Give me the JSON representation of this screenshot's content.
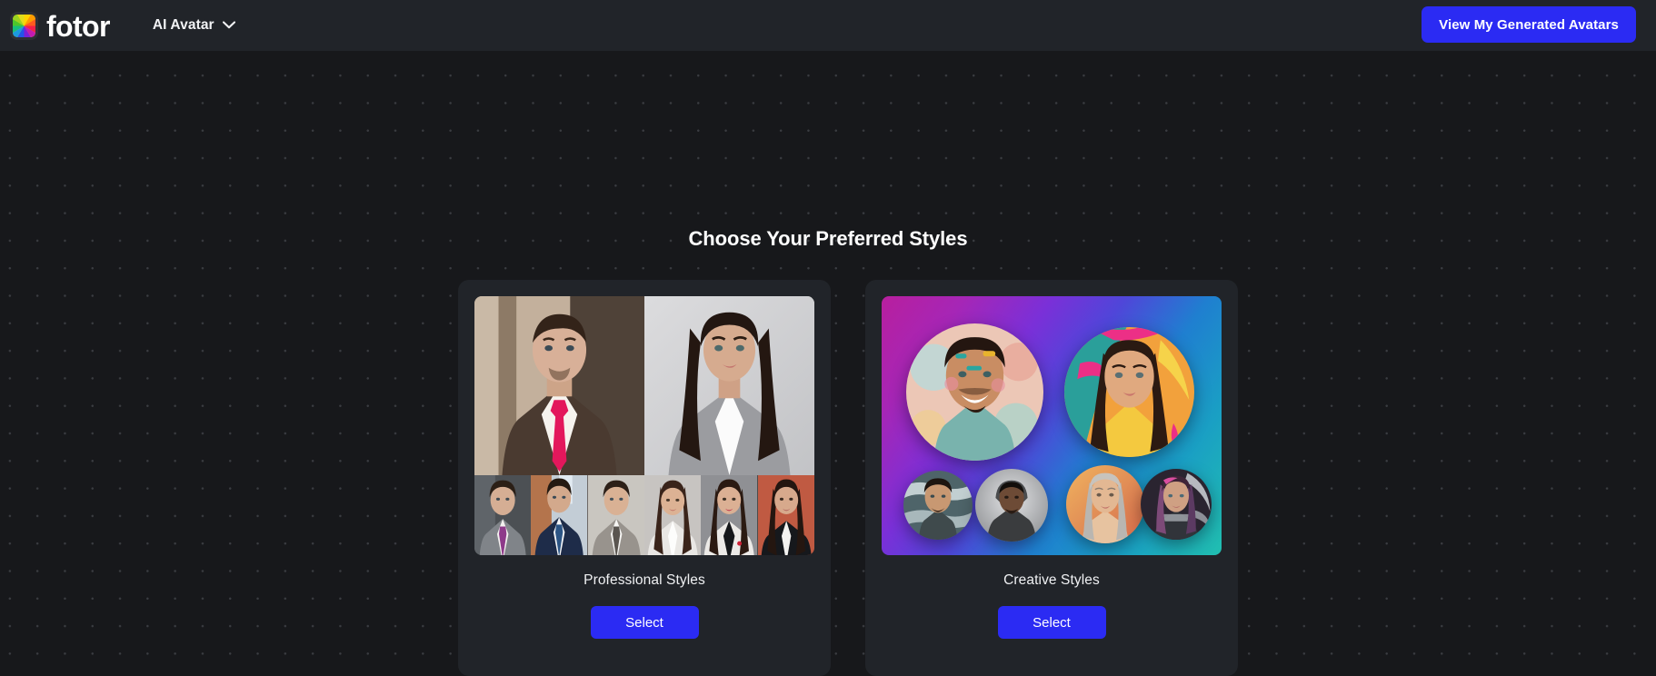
{
  "header": {
    "brand_name": "fotor",
    "brand_icon": "fotor-color-wheel-logo",
    "nav": {
      "label": "AI Avatar",
      "chevron_icon": "chevron-down-icon"
    },
    "cta_label": "View My Generated Avatars"
  },
  "main": {
    "heading": "Choose Your Preferred Styles",
    "cards": [
      {
        "id": "professional",
        "title": "Professional Styles",
        "button_label": "Select",
        "preview": {
          "type": "photo-grid",
          "hero": [
            {
              "alt": "man in brown suit with pink tie",
              "bg": "#b9a696",
              "suit": "#4a3a30",
              "tie": "#e3175c",
              "skin": "#d8b098",
              "hair": "#332319"
            },
            {
              "alt": "woman in grey blazer",
              "bg": "#cfd0d2",
              "suit": "#9b9ca0",
              "tie": "#ffffff",
              "skin": "#d6ab8f",
              "hair": "#221611"
            }
          ],
          "thumbs": [
            {
              "alt": "man grey suit purple tie",
              "bg": "#55585c",
              "suit": "#808489",
              "tie": "#8e3a8a",
              "skin": "#d5ae94",
              "hair": "#2b1f16"
            },
            {
              "alt": "man navy suit blue tie",
              "bg": "#b4744c",
              "suit": "#1e2c49",
              "tie": "#2c5585",
              "skin": "#d3a98c",
              "hair": "#251a12"
            },
            {
              "alt": "man light grey suit",
              "bg": "#c9c6c0",
              "suit": "#98938d",
              "tie": "#5a5550",
              "skin": "#d9b194",
              "hair": "#2d2018"
            },
            {
              "alt": "woman white blazer",
              "bg": "#c7c4c1",
              "suit": "#e9e7e4",
              "tie": "#ffffff",
              "skin": "#dcb294",
              "hair": "#3a241a"
            },
            {
              "alt": "woman white blazer black top",
              "bg": "#8f9094",
              "suit": "#eceae7",
              "tie": "#15171a",
              "skin": "#dbb094",
              "hair": "#2b1a12"
            },
            {
              "alt": "woman black blazer orange backdrop",
              "bg": "#c05a42",
              "suit": "#16181c",
              "tie": "#ffffff",
              "skin": "#d7a98c",
              "hair": "#241610"
            }
          ]
        }
      },
      {
        "id": "creative",
        "title": "Creative Styles",
        "button_label": "Select",
        "preview": {
          "type": "gradient-orbs",
          "gradient": [
            "#b81f9e",
            "#7a30d8",
            "#1f7fd0",
            "#21bfb0"
          ],
          "orbs": [
            {
              "alt": "man with colorful paint splashes",
              "size": "large",
              "bg": "#e8c3b4",
              "skin": "#c98d63",
              "hair": "#241610",
              "accent": "#2aa6a0"
            },
            {
              "alt": "woman painted portrait orange pink",
              "size": "large",
              "bg": "#f2a13c",
              "skin": "#e0a97f",
              "hair": "#2a1a12",
              "accent": "#ec2f86"
            },
            {
              "alt": "man cloudy sky backdrop",
              "size": "small",
              "bg": "#4e6469",
              "skin": "#c89872",
              "hair": "#1d1510",
              "accent": "#d7e2e4"
            },
            {
              "alt": "man in hoodie greyscale",
              "size": "small",
              "bg": "#b7b9bb",
              "skin": "#6d4b36",
              "hair": "#120e0b",
              "accent": "#3a3c3e"
            },
            {
              "alt": "woman silver hair warm backdrop",
              "size": "small",
              "bg": "#e8a65a",
              "skin": "#e3b893",
              "hair": "#b9b6b1",
              "accent": "#d96a4a"
            },
            {
              "alt": "woman cyberpunk pink highlights",
              "size": "small",
              "bg": "#2a2430",
              "skin": "#cfa083",
              "hair": "#7d4a78",
              "accent": "#d94ea0"
            }
          ]
        }
      }
    ]
  },
  "theme": {
    "page_bg": "#17181b",
    "surface_bg": "#212429",
    "accent_blue": "#2b2bf3",
    "text_primary": "#ffffff",
    "dot_color": "#3a3c41"
  }
}
